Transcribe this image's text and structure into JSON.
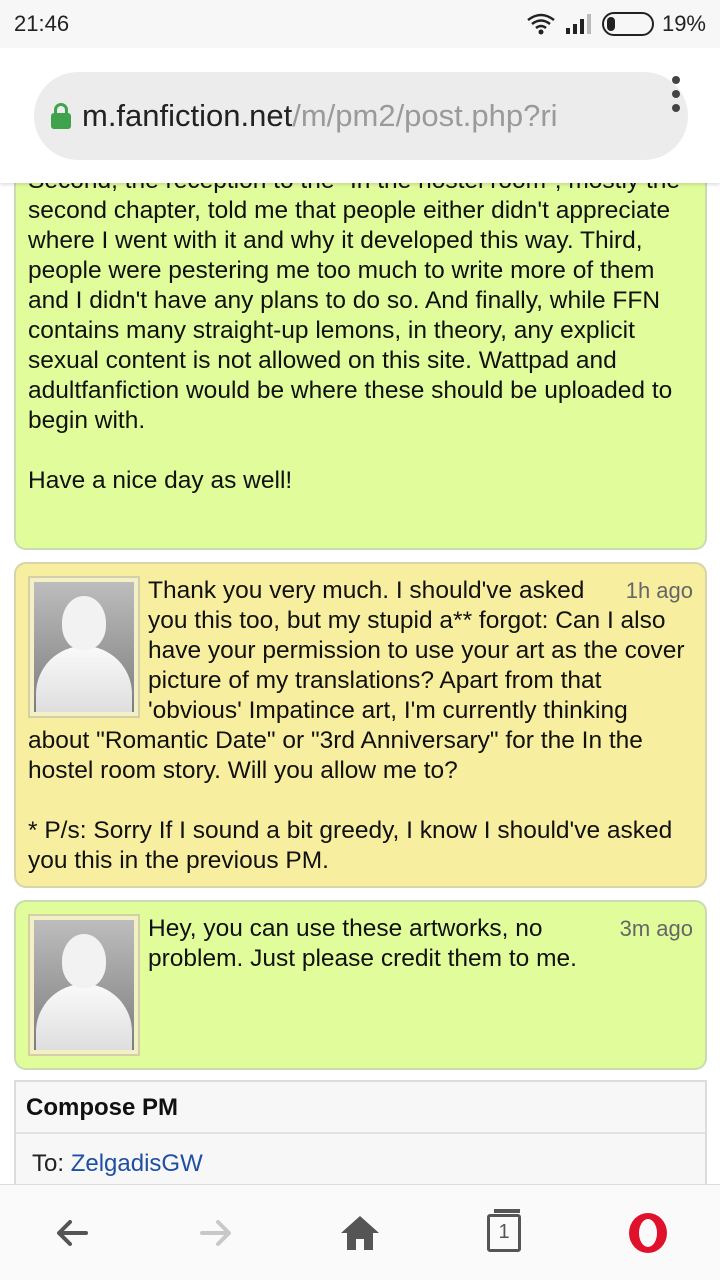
{
  "status_bar": {
    "time": "21:46",
    "battery": "19%",
    "icons": [
      "wifi-icon",
      "signal-icon",
      "battery-icon"
    ]
  },
  "browser": {
    "url_host": "m.fanfiction.net",
    "url_path": "/m/pm2/post.php?ri",
    "menu_icon": "kebab-menu-icon"
  },
  "messages": [
    {
      "style": "green",
      "avatar": false,
      "time": "",
      "text": "for several reasons: first, I didn't like how they were written. Second, the reception to the \"In the hostel room\", mostly the second chapter, told me that people either didn't appreciate where I went with it and why it developed this way. Third, people were pestering me too much to write more of them and I didn't have any plans to do so. And finally, while FFN contains many straight-up lemons, in theory, any explicit sexual content is not allowed on this site. Wattpad and adultfanfiction would be where these should be uploaded to begin with.\n\nHave a nice day as well!"
    },
    {
      "style": "yellow",
      "avatar": true,
      "time": "1h ago",
      "text": "Thank you very much. I should've asked you this too, but my stupid a** forgot: Can I also have your permission to use your art as the cover picture of my translations? Apart from that 'obvious' Impatince art, I'm currently thinking about \"Romantic Date\" or \"3rd Anniversary\" for the In the hostel room story. Will you allow me to?\n\n* P/s: Sorry If I sound a bit greedy, I know I should've asked you this in the previous PM."
    },
    {
      "style": "green",
      "avatar": true,
      "time": "3m ago",
      "text": "Hey, you can use these artworks, no problem. Just please credit them to me."
    }
  ],
  "compose": {
    "title": "Compose PM",
    "to_label": "To: ",
    "to_value": "ZelgadisGW"
  },
  "bottom_nav": {
    "tab_count": "1",
    "items": [
      "back-icon",
      "forward-icon",
      "home-icon",
      "tabs-icon",
      "opera-logo-icon"
    ]
  },
  "colors": {
    "green_bubble": "#e1fd9b",
    "yellow_bubble": "#f8ee9f",
    "lock_green": "#3fa34d",
    "link_blue": "#1f4fa3",
    "opera_red": "#e0112b"
  }
}
